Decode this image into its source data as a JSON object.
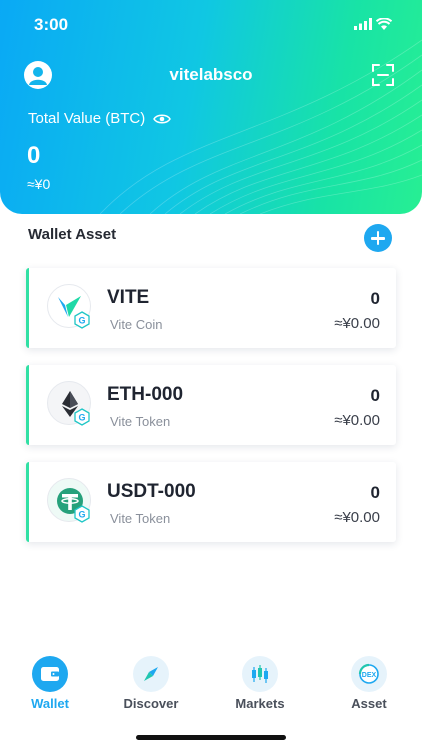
{
  "status_bar": {
    "time": "3:00"
  },
  "header": {
    "wallet_name": "vitelabsco",
    "total_label": "Total Value (BTC)",
    "total_value": "0",
    "total_fiat": "≈¥0"
  },
  "section": {
    "title": "Wallet Asset"
  },
  "assets": [
    {
      "symbol": "VITE",
      "name": "Vite Coin",
      "amount": "0",
      "fiat": "≈¥0.00",
      "icon": "vite-coin-icon"
    },
    {
      "symbol": "ETH-000",
      "name": "Vite Token",
      "amount": "0",
      "fiat": "≈¥0.00",
      "icon": "eth-coin-icon"
    },
    {
      "symbol": "USDT-000",
      "name": "Vite Token",
      "amount": "0",
      "fiat": "≈¥0.00",
      "icon": "usdt-coin-icon"
    }
  ],
  "tabs": [
    {
      "label": "Wallet",
      "icon": "wallet-icon",
      "active": true
    },
    {
      "label": "Discover",
      "icon": "compass-icon",
      "active": false
    },
    {
      "label": "Markets",
      "icon": "candlestick-icon",
      "active": false
    },
    {
      "label": "Asset",
      "icon": "dex-icon",
      "active": false
    }
  ],
  "colors": {
    "gradient_start": "#0aa9f5",
    "gradient_end": "#27ef93",
    "accent": "#1ea8f0",
    "card_accent": "#31e0a4"
  }
}
